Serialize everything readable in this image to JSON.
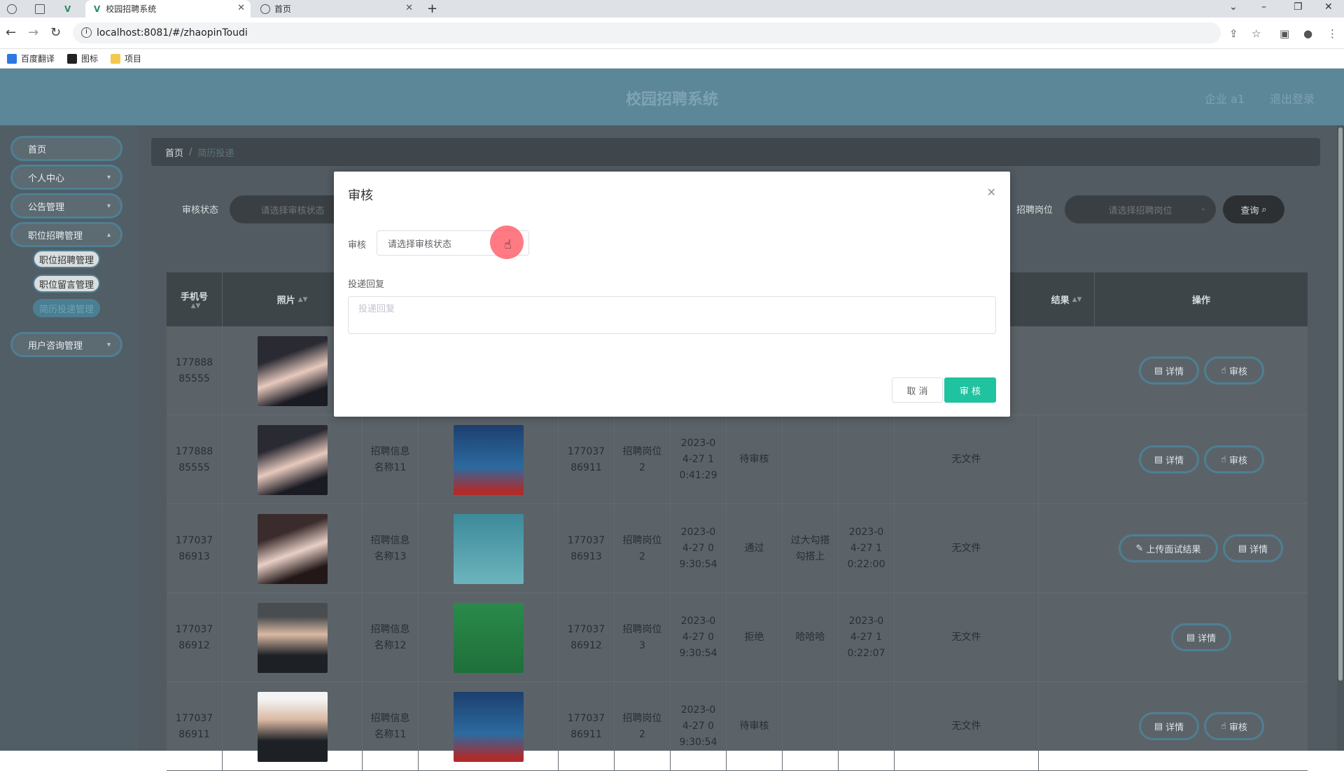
{
  "browser": {
    "tabs": [
      {
        "label": ""
      },
      {
        "label": ""
      },
      {
        "label": ""
      },
      {
        "label": "校园招聘系统"
      },
      {
        "label": "首页"
      }
    ],
    "url": "localhost:8081/#/zhaopinToudi",
    "bookmarks": [
      "百度翻译",
      "图标",
      "项目"
    ]
  },
  "header": {
    "title": "校园招聘系统",
    "user": "企业 a1",
    "logout": "退出登录"
  },
  "sidebar": {
    "items": [
      {
        "label": "首页"
      },
      {
        "label": "个人中心"
      },
      {
        "label": "公告管理"
      },
      {
        "label": "职位招聘管理"
      },
      {
        "label": "用户咨询管理"
      }
    ],
    "subitems": [
      {
        "label": "职位招聘管理"
      },
      {
        "label": "职位留言管理"
      },
      {
        "label": "简历投递管理"
      }
    ]
  },
  "breadcrumb": {
    "home": "首页",
    "sep": "/",
    "current": "简历投递"
  },
  "filters": {
    "status_label": "审核状态",
    "status_placeholder": "请选择审核状态",
    "post_label": "招聘岗位",
    "post_placeholder": "请选择招聘岗位",
    "query": "查询"
  },
  "table": {
    "headers": {
      "phone": "手机号",
      "photo": "照片",
      "result": "结果",
      "actions": "操作"
    },
    "rows": [
      {
        "phone": "17788885555",
        "info": "",
        "post": "",
        "phone2": "",
        "position": "",
        "time": "",
        "status": "",
        "reply": "",
        "rtime": "",
        "file": "",
        "btns": [
          "详情",
          "审核"
        ]
      },
      {
        "phone": "17788885555",
        "info": "招聘信息名称11",
        "phone2": "17703786911",
        "position": "招聘岗位2",
        "time": "2023-04-27 10:41:29",
        "status": "待审核",
        "reply": "",
        "rtime": "",
        "file": "无文件",
        "btns": [
          "详情",
          "审核"
        ]
      },
      {
        "phone": "17703786913",
        "info": "招聘信息名称13",
        "phone2": "17703786913",
        "position": "招聘岗位2",
        "time": "2023-04-27 09:30:54",
        "status": "通过",
        "reply": "过大勾搭勾搭上",
        "rtime": "2023-04-27 10:22:00",
        "file": "无文件",
        "btns": [
          "上传面试结果",
          "详情"
        ]
      },
      {
        "phone": "17703786912",
        "info": "招聘信息名称12",
        "phone2": "17703786912",
        "position": "招聘岗位3",
        "time": "2023-04-27 09:30:54",
        "status": "拒绝",
        "reply": "哈哈哈",
        "rtime": "2023-04-27 10:22:07",
        "file": "无文件",
        "btns": [
          "详情"
        ]
      },
      {
        "phone": "17703786911",
        "info": "招聘信息名称11",
        "phone2": "17703786911",
        "position": "招聘岗位2",
        "time": "2023-04-27 09:30:54",
        "status": "待审核",
        "reply": "",
        "rtime": "",
        "file": "无文件",
        "btns": [
          "详情",
          "审核"
        ]
      }
    ]
  },
  "modal": {
    "title": "审核",
    "audit_label": "审核",
    "audit_placeholder": "请选择审核状态",
    "reply_label": "投递回复",
    "reply_placeholder": "投递回复",
    "cancel": "取 消",
    "ok": "审 核"
  },
  "colors": {
    "header": "#5b8799",
    "accent": "#1fc39f",
    "border": "#4e7f93"
  }
}
